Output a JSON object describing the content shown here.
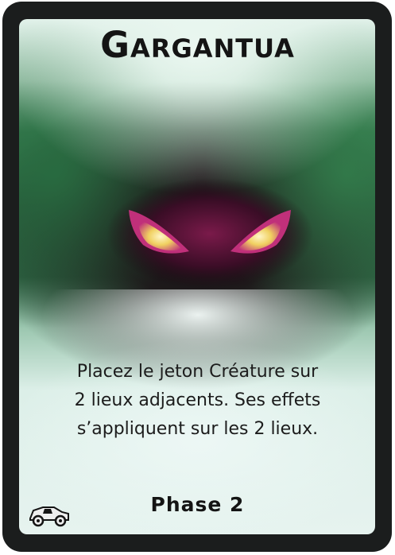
{
  "card": {
    "title": "Gargantua",
    "description_lines": [
      "Placez le jeton Créature sur",
      "2 lieux adjacents. Ses effets",
      "s’appliquent sur les 2 lieux."
    ],
    "phase_label": "Phase 2",
    "icon": "vehicle-icon",
    "colors": {
      "border": "#1b1d1d",
      "fog_green": "#2e6444",
      "mist": "#e6f3ef",
      "eye_glow": "#f0d060",
      "creature_magenta": "#b4286e",
      "text": "#141414"
    }
  }
}
